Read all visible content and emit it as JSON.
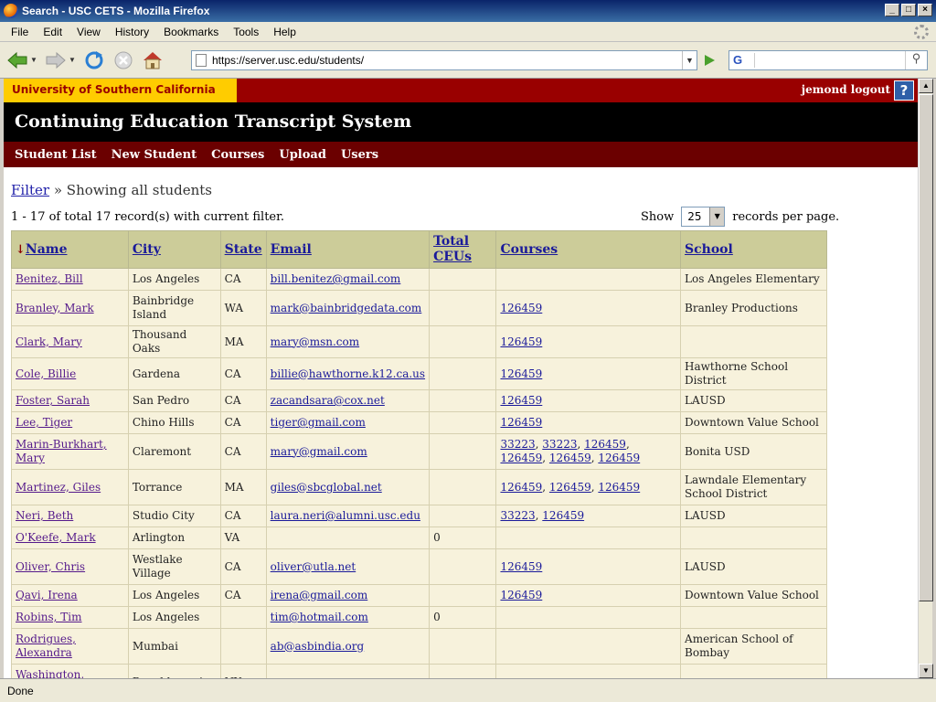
{
  "window": {
    "title": "Search - USC CETS - Mozilla Firefox"
  },
  "menu": [
    "File",
    "Edit",
    "View",
    "History",
    "Bookmarks",
    "Tools",
    "Help"
  ],
  "url": "https://server.usc.edu/students/",
  "search_engine": "G",
  "header": {
    "university": "University of Southern California",
    "user": "jemond logout",
    "help": "?",
    "system_title": "Continuing Education Transcript System",
    "nav": [
      "Student List",
      "New Student",
      "Courses",
      "Upload",
      "Users"
    ]
  },
  "filter": {
    "link": "Filter",
    "text": "» Showing all students",
    "record_count": "1 - 17 of total 17 record(s) with current filter.",
    "show_label": "Show",
    "per_page": "25",
    "per_page_suffix": "records per page."
  },
  "table": {
    "sort_arrow": "↓",
    "headers": [
      "Name",
      "City",
      "State",
      "Email",
      "Total CEUs",
      "Courses",
      "School"
    ],
    "rows": [
      {
        "name": "Benitez, Bill",
        "city": "Los Angeles",
        "state": "CA",
        "email": "bill.benitez@gmail.com",
        "ceus": "",
        "courses": [],
        "school": "Los Angeles Elementary"
      },
      {
        "name": "Branley, Mark",
        "city": "Bainbridge Island",
        "state": "WA",
        "email": "mark@bainbridgedata.com",
        "ceus": "",
        "courses": [
          "126459"
        ],
        "school": "Branley Productions"
      },
      {
        "name": "Clark, Mary",
        "city": "Thousand Oaks",
        "state": "MA",
        "email": "mary@msn.com",
        "ceus": "",
        "courses": [
          "126459"
        ],
        "school": ""
      },
      {
        "name": "Cole, Billie",
        "city": "Gardena",
        "state": "CA",
        "email": "billie@hawthorne.k12.ca.us",
        "ceus": "",
        "courses": [
          "126459"
        ],
        "school": "Hawthorne School District"
      },
      {
        "name": "Foster, Sarah",
        "city": "San Pedro",
        "state": "CA",
        "email": "zacandsara@cox.net",
        "ceus": "",
        "courses": [
          "126459"
        ],
        "school": "LAUSD"
      },
      {
        "name": "Lee, Tiger",
        "city": "Chino Hills",
        "state": "CA",
        "email": "tiger@gmail.com",
        "ceus": "",
        "courses": [
          "126459"
        ],
        "school": "Downtown Value School"
      },
      {
        "name": "Marin-Burkhart, Mary",
        "city": "Claremont",
        "state": "CA",
        "email": "mary@gmail.com",
        "ceus": "",
        "courses": [
          "33223",
          "33223",
          "126459",
          "126459",
          "126459",
          "126459"
        ],
        "school": "Bonita USD"
      },
      {
        "name": "Martinez, Giles",
        "city": "Torrance",
        "state": "MA",
        "email": "giles@sbcglobal.net",
        "ceus": "",
        "courses": [
          "126459",
          "126459",
          "126459"
        ],
        "school": "Lawndale Elementary School District"
      },
      {
        "name": "Neri, Beth",
        "city": "Studio City",
        "state": "CA",
        "email": "laura.neri@alumni.usc.edu",
        "ceus": "",
        "courses": [
          "33223",
          "126459"
        ],
        "school": "LAUSD"
      },
      {
        "name": "O'Keefe, Mark",
        "city": "Arlington",
        "state": "VA",
        "email": "",
        "ceus": "0",
        "courses": [],
        "school": ""
      },
      {
        "name": "Oliver, Chris",
        "city": "Westlake Village",
        "state": "CA",
        "email": "oliver@utla.net",
        "ceus": "",
        "courses": [
          "126459"
        ],
        "school": "LAUSD"
      },
      {
        "name": "Qavi, Irena",
        "city": "Los Angeles",
        "state": "CA",
        "email": "irena@gmail.com",
        "ceus": "",
        "courses": [
          "126459"
        ],
        "school": "Downtown Value School"
      },
      {
        "name": "Robins, Tim",
        "city": "Los Angeles",
        "state": "",
        "email": "tim@hotmail.com",
        "ceus": "0",
        "courses": [],
        "school": ""
      },
      {
        "name": "Rodrigues, Alexandra",
        "city": "Mumbai",
        "state": "",
        "email": "ab@asbindia.org",
        "ceus": "",
        "courses": [],
        "school": "American School of Bombay"
      },
      {
        "name": "Washington, Deborah",
        "city": "Poughkeepsie",
        "state": "NY",
        "email": "",
        "ceus": "",
        "courses": [],
        "school": ""
      }
    ]
  },
  "status": "Done"
}
